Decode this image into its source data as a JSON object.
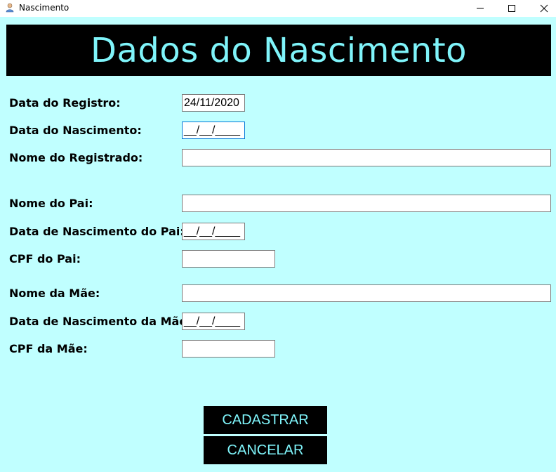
{
  "window": {
    "title": "Nascimento",
    "icon": "user-app-icon"
  },
  "header": {
    "title": "Dados do Nascimento",
    "bg_color": "#000000",
    "text_color": "#7ff4fa"
  },
  "form": {
    "data_registro": {
      "label": "Data do Registro:",
      "value": "24/11/2020"
    },
    "data_nascimento": {
      "label": "Data do Nascimento:",
      "value": "__/__/____"
    },
    "nome_registrado": {
      "label": "Nome do Registrado:",
      "value": ""
    },
    "nome_pai": {
      "label": "Nome do Pai:",
      "value": ""
    },
    "data_nasc_pai": {
      "label": "Data de Nascimento do Pai:",
      "value": "__/__/____"
    },
    "cpf_pai": {
      "label": "CPF do Pai:",
      "value": ""
    },
    "nome_mae": {
      "label": "Nome da Mãe:",
      "value": ""
    },
    "data_nasc_mae": {
      "label": "Data de Nascimento da Mãe:",
      "value": "__/__/____"
    },
    "cpf_mae": {
      "label": "CPF da Mãe:",
      "value": ""
    }
  },
  "buttons": {
    "cadastrar": "CADASTRAR",
    "cancelar": "CANCELAR"
  },
  "colors": {
    "background": "#c0ffff",
    "accent": "#7ff4fa"
  }
}
